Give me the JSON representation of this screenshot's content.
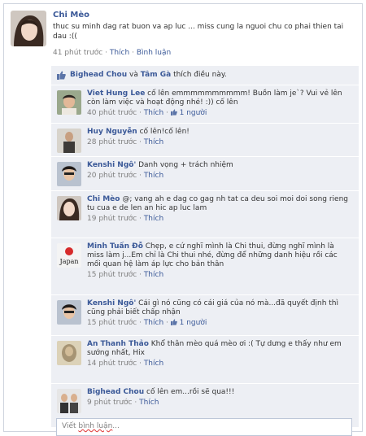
{
  "post": {
    "author": "Chi Mèo",
    "text": "thuc su minh dag rat buon va ap luc ... miss cung la nguoi chu co phai thien tai dau :((",
    "time": "41 phút trước",
    "like_label": "Thích",
    "comment_label": "Bình luận",
    "sep": "·"
  },
  "likes": {
    "name1": "Bighead Chou",
    "and": " và ",
    "name2": "Tâm Gà",
    "suffix": " thích điều này."
  },
  "comments": [
    {
      "name": "Viet Hung Lee",
      "text": "cố lên emmmmmmmmmm! Buồn làm je`? Vui vẻ lên còn làm việc và hoạt động nhé! :)) cố lên",
      "time": "40 phút trước",
      "like": "Thích",
      "likes": "1 người"
    },
    {
      "name": "Huy Nguyễn",
      "text": "cố lên!cố lên!",
      "time": "28 phút trước",
      "like": "Thích",
      "likes": ""
    },
    {
      "name": "Kenshi Ngô'",
      "text": "Danh vọng + trách nhiệm",
      "time": "20 phút trước",
      "like": "Thích",
      "likes": ""
    },
    {
      "name": "Chi Mèo",
      "text": "@; vang ah e dag co gag nh tat ca deu soi moi doi song rieng tu cua e de len an hic ap luc lam",
      "time": "19 phút trước",
      "like": "Thích",
      "likes": ""
    },
    {
      "name": "Minh Tuấn Đỗ",
      "text": "Chẹp, e cứ nghĩ mình là Chi thui, đừng nghĩ mình là miss làm j...Em chỉ là Chi thui nhé, đừng để những danh hiệu rồi các mối quan hệ làm áp lực cho bản thân",
      "time": "15 phút trước",
      "like": "Thích",
      "likes": ""
    },
    {
      "name": "Kenshi Ngô'",
      "text": "Cái gì nó cũng có cái giá của nó mà...đã quyết định thì cũng phải biết chấp nhận",
      "time": "15 phút trước",
      "like": "Thích",
      "likes": "1 người"
    },
    {
      "name": "An Thanh Thảo",
      "text": "Khổ thân mèo quá mèo ơi :( Tự dưng e thấy như em sướng nhất, Hix",
      "time": "14 phút trước",
      "like": "Thích",
      "likes": ""
    },
    {
      "name": "Bighead Chou",
      "text": "cố lên em...rồi sẽ qua!!!",
      "time": "9 phút trước",
      "like": "Thích",
      "likes": ""
    }
  ],
  "composer": {
    "placeholder_a": "Viết ",
    "placeholder_b": "bình luận",
    "placeholder_c": "..."
  },
  "avatar_text": {
    "japan": "Japan"
  },
  "icons": {
    "like": "thumbs-up-icon"
  },
  "colors": {
    "link": "#3b5998",
    "feedback_bg": "#edeff4",
    "meta": "#7f7f7f"
  }
}
